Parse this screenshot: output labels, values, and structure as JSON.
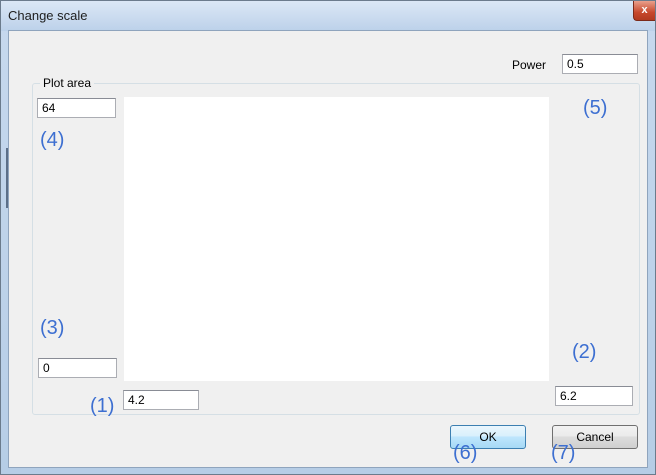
{
  "window": {
    "title": "Change scale",
    "close_glyph": "x"
  },
  "power": {
    "label": "Power",
    "value": "0.5"
  },
  "plot_area": {
    "label": "Plot area",
    "y_max": "64",
    "y_min": "0",
    "x_min": "4.2",
    "x_max": "6.2"
  },
  "callouts": {
    "c1": "(1)",
    "c2": "(2)",
    "c3": "(3)",
    "c4": "(4)",
    "c5": "(5)",
    "c6": "(6)",
    "c7": "(7)"
  },
  "buttons": {
    "ok": "OK",
    "cancel": "Cancel"
  }
}
